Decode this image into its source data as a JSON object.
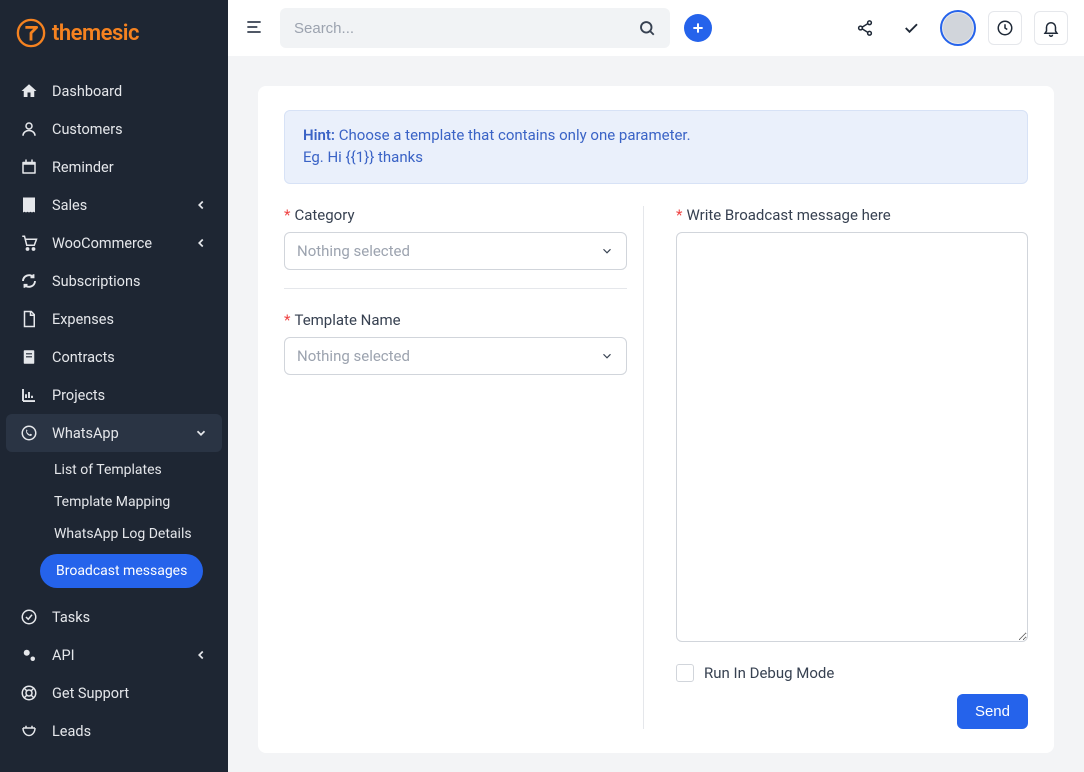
{
  "brand": {
    "name": "themesic"
  },
  "search": {
    "placeholder": "Search..."
  },
  "sidebar": {
    "items": [
      {
        "label": "Dashboard"
      },
      {
        "label": "Customers"
      },
      {
        "label": "Reminder"
      },
      {
        "label": "Sales"
      },
      {
        "label": "WooCommerce"
      },
      {
        "label": "Subscriptions"
      },
      {
        "label": "Expenses"
      },
      {
        "label": "Contracts"
      },
      {
        "label": "Projects"
      },
      {
        "label": "WhatsApp"
      },
      {
        "label": "Tasks"
      },
      {
        "label": "API"
      },
      {
        "label": "Get Support"
      },
      {
        "label": "Leads"
      }
    ],
    "whatsapp_sub": [
      {
        "label": "List of Templates"
      },
      {
        "label": "Template Mapping"
      },
      {
        "label": "WhatsApp Log Details"
      },
      {
        "label": "Broadcast messages"
      }
    ]
  },
  "hint": {
    "prefix": "Hint:",
    "line1": " Choose a template that contains only one parameter.",
    "line2": "Eg. Hi {{1}} thanks"
  },
  "form": {
    "category_label": "Category",
    "category_placeholder": "Nothing selected",
    "template_label": "Template Name",
    "template_placeholder": "Nothing selected",
    "message_label": "Write Broadcast message here",
    "debug_label": "Run In Debug Mode",
    "send_label": "Send"
  }
}
